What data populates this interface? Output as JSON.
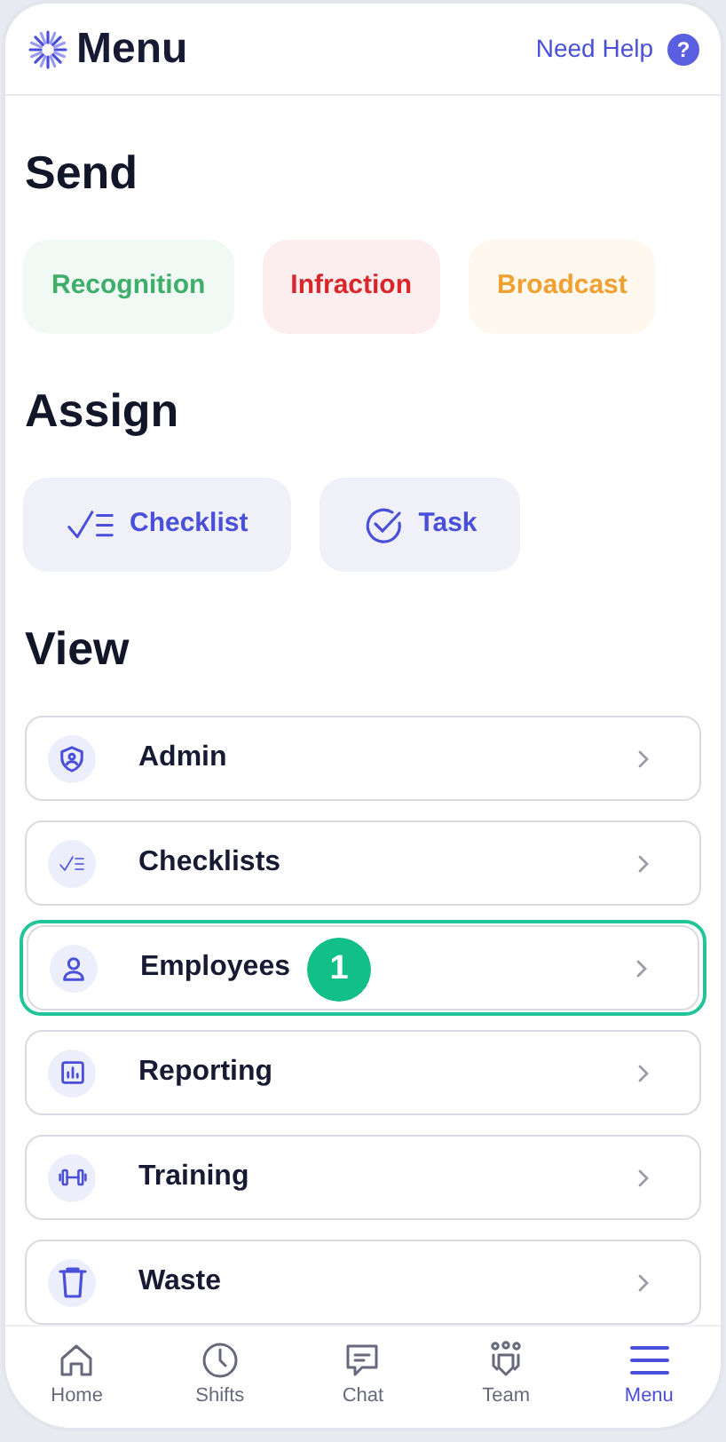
{
  "header": {
    "title": "Menu",
    "help": "Need Help",
    "help_icon": "?"
  },
  "sections": [
    {
      "title": "Send",
      "buttons": [
        {
          "label": "Recognition",
          "color": "#3fae6a"
        },
        {
          "label": "Infraction",
          "color": "#d9262b"
        },
        {
          "label": "Broadcast",
          "color": "#f0a030"
        }
      ]
    },
    {
      "title": "Assign",
      "buttons": [
        {
          "label": "Checklist",
          "color": "#4a4fd9"
        },
        {
          "label": "Task",
          "color": "#4a4fd9"
        }
      ]
    },
    {
      "title": "View",
      "items": [
        {
          "label": "Admin",
          "highlighted": false
        },
        {
          "label": "Checklists",
          "highlighted": false
        },
        {
          "label": "Employees",
          "highlighted": true,
          "step": "1"
        },
        {
          "label": "Reporting",
          "highlighted": false
        },
        {
          "label": "Training",
          "highlighted": false
        },
        {
          "label": "Waste",
          "highlighted": false
        }
      ]
    }
  ],
  "tabs": [
    {
      "label": "Home",
      "selected": false
    },
    {
      "label": "Shifts",
      "selected": false
    },
    {
      "label": "Chat",
      "selected": false
    },
    {
      "label": "Team",
      "selected": false
    },
    {
      "label": "Menu",
      "selected": true
    }
  ]
}
